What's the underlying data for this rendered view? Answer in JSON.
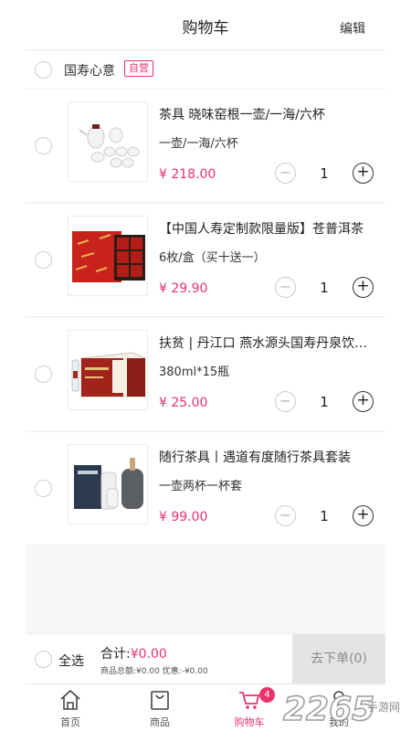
{
  "header": {
    "title": "购物车",
    "edit": "编辑"
  },
  "shop": {
    "name": "国寿心意",
    "badge": "自营"
  },
  "items": [
    {
      "name": "茶具 晓味窑根一壶/一海/六杯",
      "spec": "一壶/一海/六杯",
      "price": "¥ 218.00",
      "qty": "1"
    },
    {
      "name": "【中国人寿定制款限量版】苍普洱茶",
      "spec": "6枚/盒（买十送一）",
      "price": "¥ 29.90",
      "qty": "1"
    },
    {
      "name": "扶贫 | 丹江口 燕水源头国寿丹泉饮用水",
      "spec": "380ml*15瓶",
      "price": "¥ 25.00",
      "qty": "1"
    },
    {
      "name": "随行茶具丨遇道有度随行茶具套装",
      "spec": "一壶两杯一杯套",
      "price": "¥ 99.00",
      "qty": "1"
    }
  ],
  "footer": {
    "select_all": "全选",
    "total_label": "合计:",
    "total_amount": "¥0.00",
    "detail": "商品总额:¥0.00 优惠:-¥0.00",
    "checkout": "去下单(0)"
  },
  "tabs": [
    {
      "label": "首页",
      "icon": "home-icon"
    },
    {
      "label": "商品",
      "icon": "shopping-bag-icon"
    },
    {
      "label": "购物车",
      "icon": "cart-icon",
      "badge": "4"
    },
    {
      "label": "我的",
      "icon": "user-icon"
    }
  ],
  "watermark": {
    "text": "2265",
    "site": "手游网"
  },
  "colors": {
    "accent": "#e8336b",
    "background": "#f7f7f7",
    "checkout_disabled": "#e4e4e4"
  }
}
